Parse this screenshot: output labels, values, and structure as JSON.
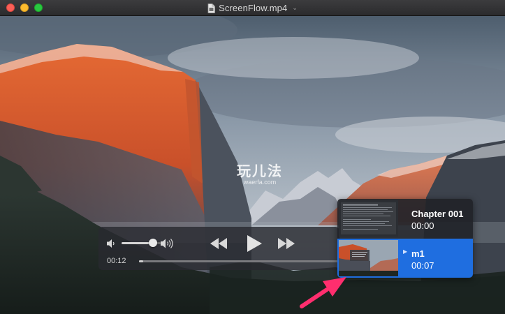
{
  "window": {
    "title": "ScreenFlow.mp4",
    "title_chevron": "⌄",
    "doc_icon": "document-icon"
  },
  "watermark": {
    "cn_text": "玩儿法",
    "url_text": "waerfa.com"
  },
  "player": {
    "elapsed": "00:12",
    "progress": 0.02,
    "volume": 0.78,
    "icons": {
      "volume_low": "speaker-low-icon",
      "volume_high": "speaker-high-icon",
      "rewind": "rewind-icon",
      "play": "play-icon",
      "fast_forward": "fast-forward-icon"
    }
  },
  "chapters": [
    {
      "name": "Chapter 001",
      "time": "00:00",
      "selected": false
    },
    {
      "name": "m1",
      "time": "00:07",
      "selected": true
    }
  ],
  "colors": {
    "selection": "#1f6ee0",
    "arrow": "#ff2e6e",
    "hud_bg": "#282a30"
  }
}
